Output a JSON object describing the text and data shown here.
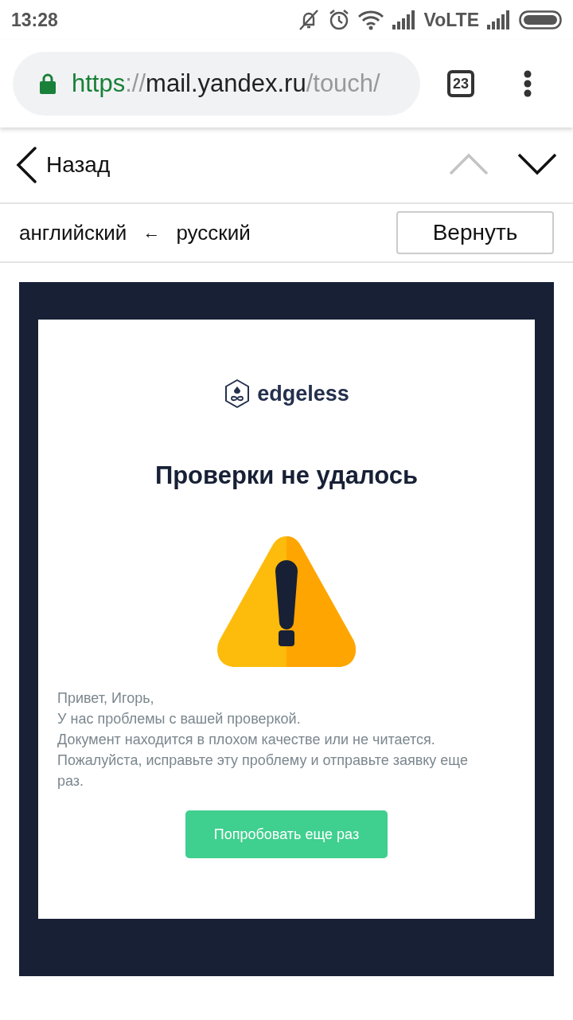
{
  "status_bar": {
    "time": "13:28",
    "network": "VoLTE"
  },
  "browser": {
    "url": {
      "scheme": "https",
      "separator": "://",
      "host": "mail.yandex.ru",
      "path": "/touch/"
    },
    "tab_count": "23"
  },
  "nav": {
    "back": "Назад",
    "prev_disabled": true,
    "next_disabled": false
  },
  "translate": {
    "from": "английский",
    "arrow": "←",
    "to": "русский",
    "button": "Вернуть"
  },
  "email": {
    "brand": "edgeless",
    "title": "Проверки не удалось",
    "lines": [
      "Привет, Игорь,",
      "У нас проблемы с вашей проверкой.",
      "Документ находится в плохом качестве или не читается.",
      "Пожалуйста, исправьте эту проблему и отправьте заявку еще раз."
    ],
    "button": "Попробовать еще раз"
  }
}
